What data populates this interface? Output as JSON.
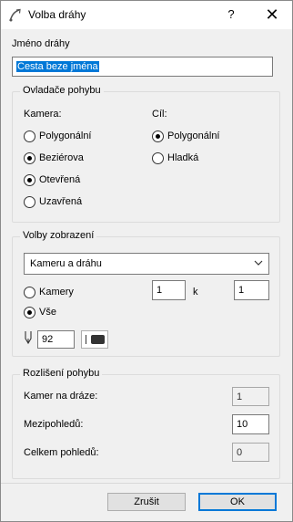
{
  "window": {
    "title": "Volba dráhy",
    "help": "?",
    "close": "✕"
  },
  "path_name": {
    "label": "Jméno dráhy",
    "value": "Cesta beze jména"
  },
  "motion_controls": {
    "title": "Ovladače pohybu",
    "camera_label": "Kamera:",
    "target_label": "Cíl:",
    "camera_options": [
      {
        "label": "Polygonální",
        "selected": false
      },
      {
        "label": "Beziérova",
        "selected": true
      },
      {
        "label": "Otevřená",
        "selected": true
      },
      {
        "label": "Uzavřená",
        "selected": false
      }
    ],
    "target_options": [
      {
        "label": "Polygonální",
        "selected": true
      },
      {
        "label": "Hladká",
        "selected": false
      }
    ]
  },
  "display_options": {
    "title": "Volby zobrazení",
    "select_value": "Kameru a dráhu",
    "cameras_label": "Kamery",
    "cameras_from": "1",
    "k_label": "k",
    "cameras_to": "1",
    "all_label": "Vše",
    "pen_value": "92",
    "selected_mode": "all"
  },
  "motion_resolution": {
    "title": "Rozlišení pohybu",
    "cameras_on_path_label": "Kamer na dráze:",
    "cameras_on_path_value": "1",
    "in_between_label": "Mezipohledů:",
    "in_between_value": "10",
    "total_views_label": "Celkem pohledů:",
    "total_views_value": "0"
  },
  "buttons": {
    "cancel": "Zrušit",
    "ok": "OK"
  }
}
